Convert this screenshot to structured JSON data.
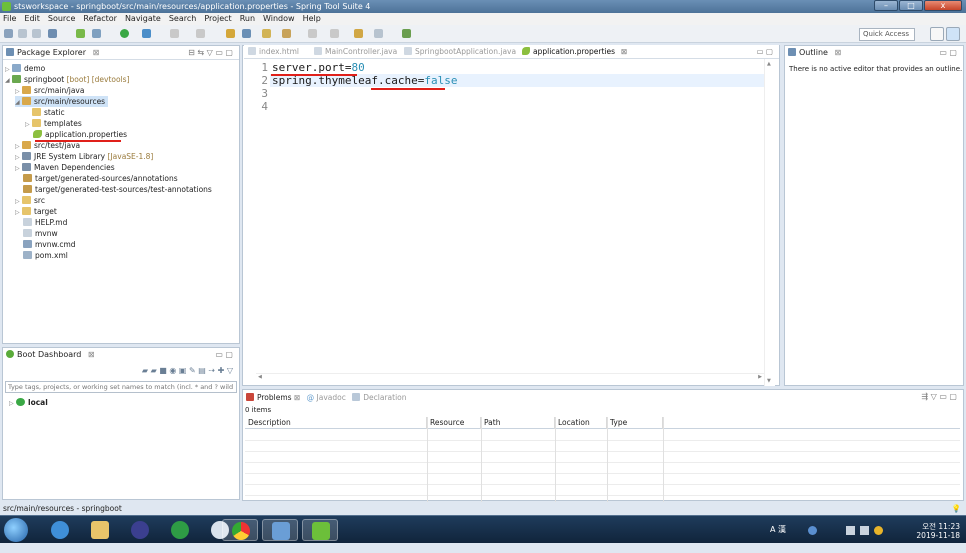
{
  "window": {
    "title": "stsworkspace - springboot/src/main/resources/application.properties - Spring Tool Suite 4",
    "min": "–",
    "max": "□",
    "close": "x"
  },
  "menu": [
    "File",
    "Edit",
    "Source",
    "Refactor",
    "Navigate",
    "Search",
    "Project",
    "Run",
    "Window",
    "Help"
  ],
  "toolbar": {
    "quick_access": "Quick Access"
  },
  "package_explorer": {
    "title": "Package Explorer",
    "items": [
      {
        "label": "demo",
        "extra": ""
      },
      {
        "label": "springboot",
        "extra": "[boot] [devtools]"
      },
      {
        "label": "src/main/java",
        "extra": ""
      },
      {
        "label": "src/main/resources",
        "extra": ""
      },
      {
        "label": "static",
        "extra": ""
      },
      {
        "label": "templates",
        "extra": ""
      },
      {
        "label": "application.properties",
        "extra": ""
      },
      {
        "label": "src/test/java",
        "extra": ""
      },
      {
        "label": "JRE System Library",
        "extra": "[JavaSE-1.8]"
      },
      {
        "label": "Maven Dependencies",
        "extra": ""
      },
      {
        "label": "target/generated-sources/annotations",
        "extra": ""
      },
      {
        "label": "target/generated-test-sources/test-annotations",
        "extra": ""
      },
      {
        "label": "src",
        "extra": ""
      },
      {
        "label": "target",
        "extra": ""
      },
      {
        "label": "HELP.md",
        "extra": ""
      },
      {
        "label": "mvnw",
        "extra": ""
      },
      {
        "label": "mvnw.cmd",
        "extra": ""
      },
      {
        "label": "pom.xml",
        "extra": ""
      }
    ]
  },
  "boot_dashboard": {
    "title": "Boot Dashboard",
    "filter_placeholder": "Type tags, projects, or working set names to match (incl. * and ? wild",
    "node": "local"
  },
  "editor": {
    "tabs": [
      "index.html",
      "MainController.java",
      "SpringbootApplication.java",
      "application.properties"
    ],
    "lines": [
      {
        "num": "1",
        "key": "server.port",
        "eq": "=",
        "value": "80"
      },
      {
        "num": "2",
        "key": "spring.thymeleaf.cache",
        "eq": "=",
        "value": "false"
      },
      {
        "num": "3",
        "key": "",
        "eq": "",
        "value": ""
      },
      {
        "num": "4",
        "key": "",
        "eq": "",
        "value": ""
      }
    ]
  },
  "outline": {
    "title": "Outline",
    "message": "There is no active editor that provides an outline."
  },
  "problems": {
    "tabs": [
      "Problems",
      "Javadoc",
      "Declaration"
    ],
    "count": "0 items",
    "columns": [
      "Description",
      "Resource",
      "Path",
      "Location",
      "Type"
    ]
  },
  "status_bar": {
    "text": "src/main/resources - springboot"
  },
  "taskbar": {
    "time": "오전 11:23",
    "date": "2019-11-18",
    "ime": "A 漢"
  },
  "colors": {
    "key": "#1a1a1a",
    "value": "#2a8fb5",
    "underline": "#e0201a"
  }
}
